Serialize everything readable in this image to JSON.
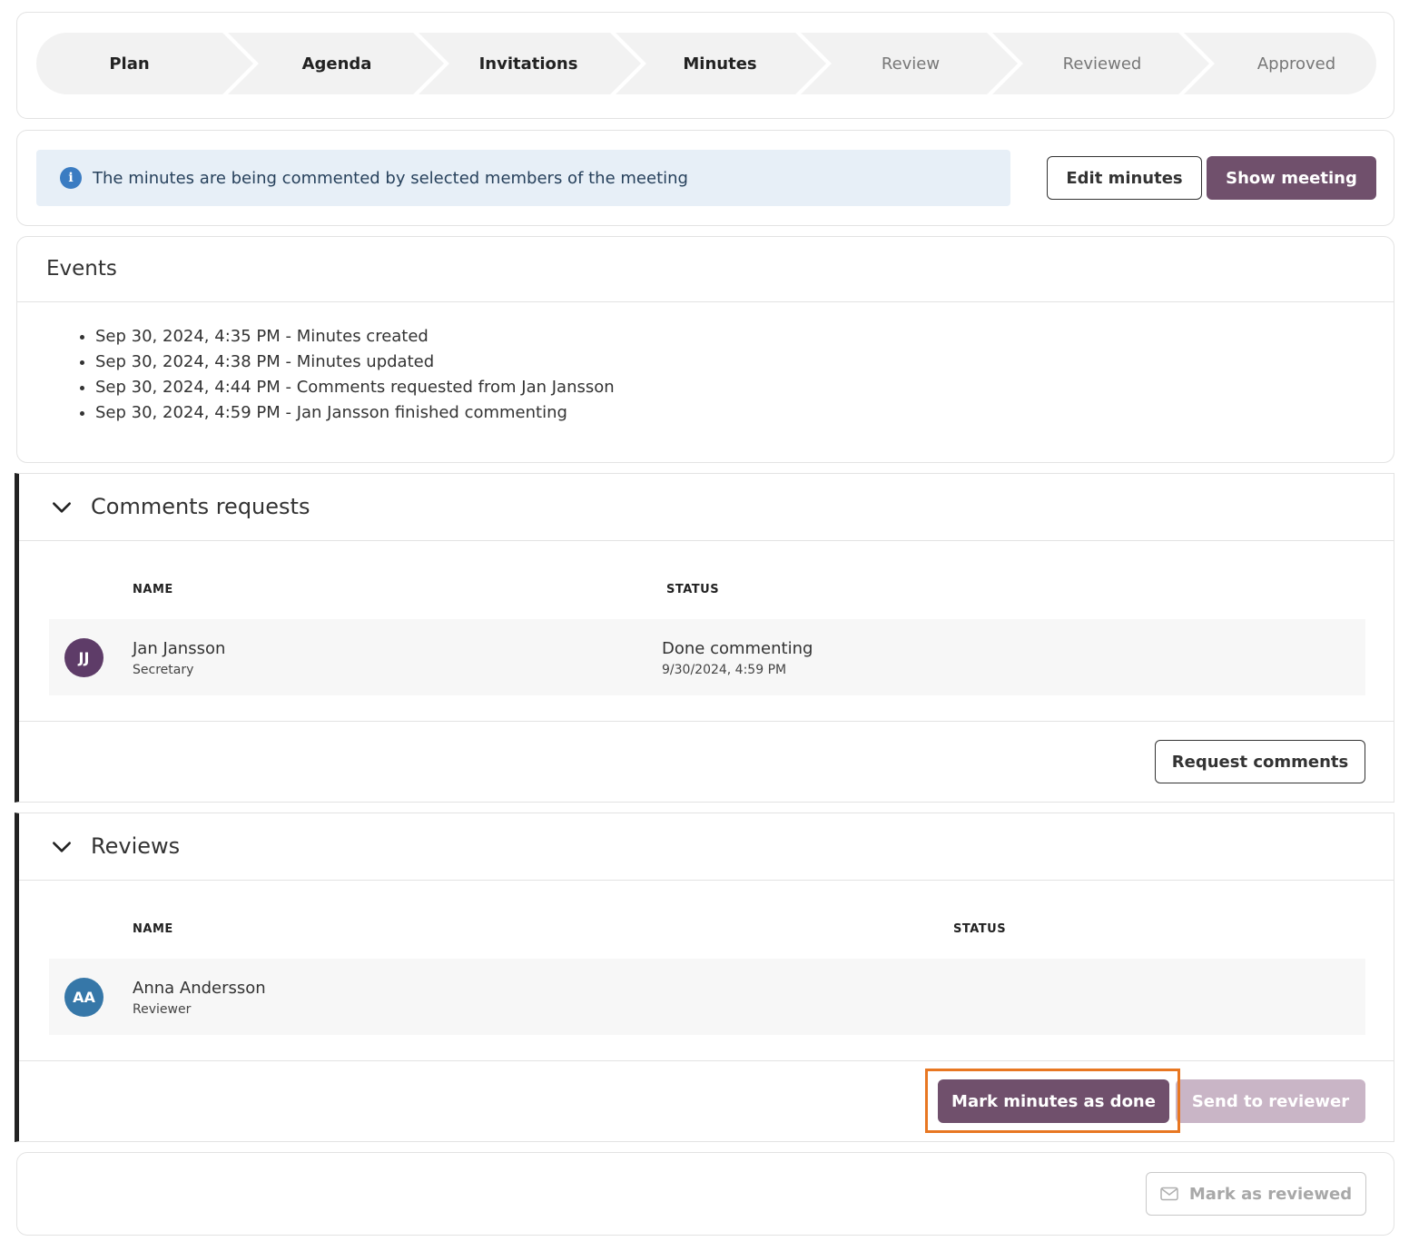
{
  "stepper": {
    "steps": [
      {
        "label": "Plan",
        "state": "done"
      },
      {
        "label": "Agenda",
        "state": "done"
      },
      {
        "label": "Invitations",
        "state": "done"
      },
      {
        "label": "Minutes",
        "state": "current"
      },
      {
        "label": "Review",
        "state": "future"
      },
      {
        "label": "Reviewed",
        "state": "future"
      },
      {
        "label": "Approved",
        "state": "future"
      }
    ]
  },
  "info": {
    "message": "The minutes are being commented by selected members of the meeting",
    "icon": "info-icon",
    "edit_label": "Edit minutes",
    "show_label": "Show meeting"
  },
  "events": {
    "title": "Events",
    "items": [
      "Sep 30, 2024, 4:35 PM - Minutes created",
      "Sep 30, 2024, 4:38 PM - Minutes updated",
      "Sep 30, 2024, 4:44 PM - Comments requested from Jan Jansson",
      "Sep 30, 2024, 4:59 PM - Jan Jansson finished commenting"
    ]
  },
  "comments": {
    "title": "Comments requests",
    "col_name": "NAME",
    "col_status": "STATUS",
    "rows": [
      {
        "initials": "JJ",
        "name": "Jan Jansson",
        "role": "Secretary",
        "status": "Done commenting",
        "status_time": "9/30/2024, 4:59 PM",
        "avatar_color": "#5e3c68"
      }
    ],
    "request_label": "Request comments"
  },
  "reviews": {
    "title": "Reviews",
    "col_name": "NAME",
    "col_status": "STATUS",
    "rows": [
      {
        "initials": "AA",
        "name": "Anna Andersson",
        "role": "Reviewer",
        "avatar_color": "#3677a8"
      }
    ],
    "mark_done_label": "Mark minutes as done",
    "send_label": "Send to reviewer"
  },
  "footer": {
    "mark_reviewed_label": "Mark as reviewed",
    "icon": "envelope-icon"
  },
  "colors": {
    "primary": "#70506c",
    "primary_disabled": "#c9b5c6",
    "info_bg": "#e7eff7",
    "highlight": "#e87722"
  }
}
